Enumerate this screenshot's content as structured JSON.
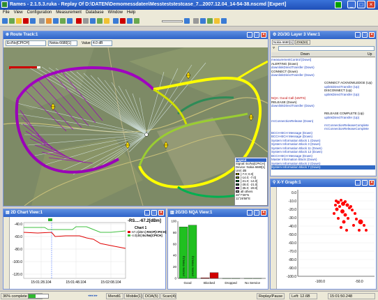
{
  "window": {
    "title": "Rames - 2.1.5.3.ruka - Replay Of D:\\DATEN\\Demomessdaten\\Messteststestcase_7...2007.12.04_14-54-38.nscmd [Expert]"
  },
  "menu": [
    "File",
    "View",
    "Configuration",
    "Measurement",
    "Database",
    "Window",
    "Help"
  ],
  "route": {
    "title": "Route Track:1",
    "source_select": "Ec/No[CPICH]",
    "device_select": "Nokia 6680[1]",
    "value_label": "Value:",
    "value_field": "4.0 dB",
    "legend": {
      "title": "Legend",
      "lines": [
        "Signal: Ec/No[CPICH]",
        "Device: Nokia 6680[1]",
        "Unit: dB"
      ],
      "bins": [
        "[-7.0; 0.0]",
        "[-14.0; -7.0]",
        "[-21.0; -14.0]",
        "[-28.0; -21.0]",
        "[-35.0; -28.0]",
        "all others"
      ],
      "colors": [
        "#ffff00",
        "#9acd32",
        "#00b050",
        "#2e8b57",
        "#a000c0",
        "#c0c0c0"
      ],
      "coords": [
        "48°7'26\"N",
        "11°26'58\"E"
      ]
    }
  },
  "layer3": {
    "title": "2G/3G Layer 3 View:1",
    "tabs": [
      "Nokia 6680[1]",
      "ZX6(53)"
    ],
    "columns": [
      "Down",
      "Up"
    ],
    "rows": [
      {
        "d": "measurementControl [Down]",
        "u": "",
        "k": "b"
      },
      {
        "d": "ALERTING (Down)",
        "u": "",
        "k": "k"
      },
      {
        "d": "downlinkDirectTransfer (Down)",
        "u": "",
        "k": "b"
      },
      {
        "d": "CONNECT (Down)",
        "u": "",
        "k": "k"
      },
      {
        "d": "downlinkDirectTransfer (Down)",
        "u": "",
        "k": "b"
      },
      {
        "d": "",
        "u": "",
        "k": "b"
      },
      {
        "d": "",
        "u": "CONNECT ACKNOWLEDGE (Up)",
        "k": "k"
      },
      {
        "d": "",
        "u": "uplinkDirectTransfer (Up)",
        "k": "b"
      },
      {
        "d": "",
        "u": "DISCONNECT (Up)",
        "k": "k"
      },
      {
        "d": "",
        "u": "uplinkDirectTransfer (Up)",
        "k": "b"
      },
      {
        "d": "NQA: Good Call (UMTS)",
        "u": "",
        "k": "r"
      },
      {
        "d": "RELEASE (Down)",
        "u": "",
        "k": "k"
      },
      {
        "d": "downlinkDirectTransfer (Down)",
        "u": "",
        "k": "b"
      },
      {
        "d": "",
        "u": "",
        "k": "b"
      },
      {
        "d": "",
        "u": "RELEASE COMPLETE (Up)",
        "k": "k"
      },
      {
        "d": "",
        "u": "uplinkDirectTransfer (Up)",
        "k": "b"
      },
      {
        "d": "rrcConnectionRelease (Down)",
        "u": "",
        "k": "b"
      },
      {
        "d": "",
        "u": "rrcConnectionReleaseComplete",
        "k": "b"
      },
      {
        "d": "",
        "u": "rrcConnectionReleaseComplete",
        "k": "b"
      },
      {
        "d": "BCCH-BCH Message (Down)",
        "u": "",
        "k": "b"
      },
      {
        "d": "BCCH-BCH Message (Down)",
        "u": "",
        "k": "b"
      },
      {
        "d": "System Information Block 1 (Down)",
        "u": "",
        "k": "b"
      },
      {
        "d": "System Information Block 3 (Down)",
        "u": "",
        "k": "b"
      },
      {
        "d": "System Information Block 11 (Down)",
        "u": "",
        "k": "b"
      },
      {
        "d": "System Information Block 12 (Down)",
        "u": "",
        "k": "b"
      },
      {
        "d": "BCCH-BCH Message (Down)",
        "u": "",
        "k": "b"
      },
      {
        "d": "Master Information Block (Down)",
        "u": "",
        "k": "b"
      },
      {
        "d": "System Information Block 2 (Down)",
        "u": "",
        "k": "b"
      },
      {
        "d": "System Information Block 7 (Down)",
        "u": "",
        "k": "b"
      }
    ]
  },
  "xy": {
    "title": "X-Y Graph:1",
    "yticks": [
      "0.0",
      "-10.0",
      "-20.0",
      "-30.0",
      "-40.0",
      "-50.0",
      "-60.0",
      "-70.0",
      "-80.0",
      "-90.0",
      "-100.0"
    ],
    "xticks": [
      "-100.0",
      "-50.0"
    ]
  },
  "chart2d": {
    "title": "2D Chart View:1",
    "readout": "-RS....-67.2[dBm]",
    "chart_label": "Chart 1",
    "yticks": [
      "-40.0",
      "-60.0",
      "-80.0",
      "-100.0",
      "-120.0"
    ],
    "xticks": [
      "15:01:28.104",
      "15:01:48.104",
      "15:02:08.104"
    ],
    "legend": [
      {
        "value": "-67.2[dBm]",
        "name": "RSCP[CPICH]",
        "color": "#e00000"
      },
      {
        "value": "-4.0[dB]",
        "name": "Ec/No[CPICH]",
        "color": "#40c040"
      }
    ]
  },
  "nqa": {
    "title": "2G/3G NQA View:1",
    "yticks": [
      "100",
      "80",
      "60",
      "40",
      "20",
      "0"
    ],
    "categories": [
      "Good",
      "Blocked",
      "Dropped",
      "No Service"
    ],
    "bar_labels": [
      "(Mobile 6680(1))",
      "(Mobile 6680(1))",
      "",
      "",
      "",
      "",
      "",
      ""
    ]
  },
  "chart_data": {
    "type": "bar",
    "categories": [
      "Good",
      "Blocked",
      "Dropped",
      "No Service"
    ],
    "series": [
      {
        "name": "",
        "values": [
          90,
          1,
          0,
          0
        ]
      },
      {
        "name": "",
        "values": [
          93,
          10,
          0,
          0
        ]
      }
    ],
    "ylim": [
      0,
      100
    ]
  },
  "status": {
    "progress_text": "36% complete",
    "progress": 0.36,
    "sheets": [
      "Mendt1",
      "Mobile(1)",
      "DOA(5)",
      "Scan(4)"
    ],
    "mode": "Replay/Pause",
    "left": "Left: 12.6B",
    "time": "15:01:50.248"
  }
}
